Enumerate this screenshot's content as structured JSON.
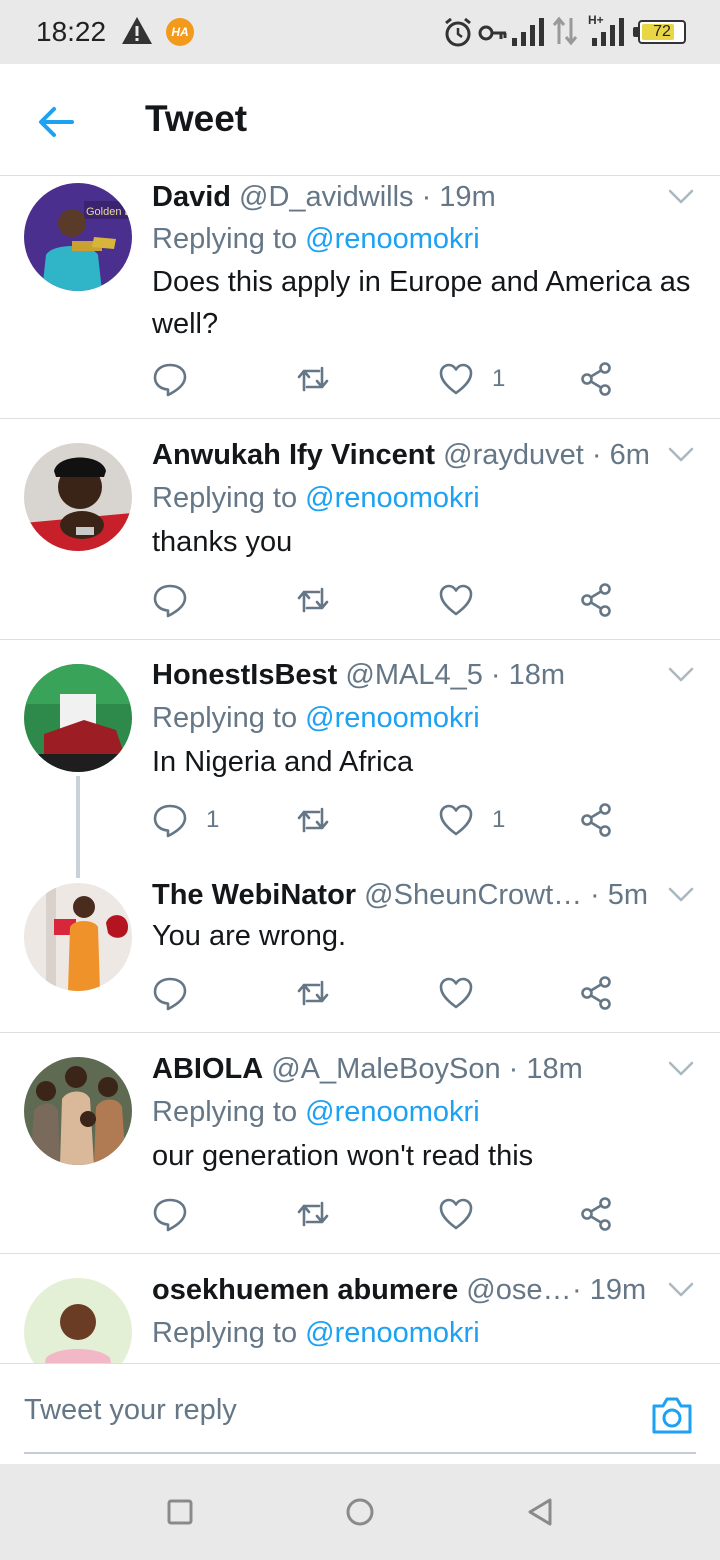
{
  "status_bar": {
    "time": "18:22",
    "battery": "72",
    "icons": [
      "warning-icon",
      "app-notification-icon",
      "alarm-icon",
      "vpn-key-icon",
      "signal-icon",
      "data-arrows-icon",
      "hplus-signal-icon",
      "battery-icon"
    ]
  },
  "header": {
    "title": "Tweet"
  },
  "tweets": [
    {
      "name": "David",
      "handle": "@D_avidwills",
      "time": "· 19m",
      "replying_prefix": "Replying to ",
      "replying_to": "@renoomokri",
      "text": "Does this apply in Europe and America as well?",
      "reply_count": "",
      "like_count": "1"
    },
    {
      "name": "Anwukah Ify Vincent",
      "handle": "@rayduvet",
      "time": "· 6m",
      "replying_prefix": "Replying to ",
      "replying_to": "@renoomokri",
      "text": "thanks you",
      "reply_count": "",
      "like_count": ""
    },
    {
      "name": "HonestIsBest",
      "handle": "@MAL4_5",
      "time": "· 18m",
      "replying_prefix": "Replying to ",
      "replying_to": "@renoomokri",
      "text": "In Nigeria and Africa",
      "reply_count": "1",
      "like_count": "1"
    },
    {
      "name": "The WebiNator",
      "handle": "@SheunCrowt…",
      "time": "· 5m",
      "text": "You are wrong.",
      "reply_count": "",
      "like_count": ""
    },
    {
      "name": "ABIOLA",
      "handle": "@A_MaleBoySon",
      "time": "· 18m",
      "replying_prefix": "Replying to ",
      "replying_to": "@renoomokri",
      "text": "our generation won't read this",
      "reply_count": "",
      "like_count": ""
    },
    {
      "name": "osekhuemen abumere",
      "handle": "@ose…",
      "time": "· 19m",
      "replying_prefix": "Replying to ",
      "replying_to": "@renoomokri"
    }
  ],
  "reply_bar": {
    "placeholder": "Tweet your reply"
  },
  "colors": {
    "accent": "#1da1f2",
    "secondary_text": "#657786",
    "divider": "#dcdfe2"
  }
}
